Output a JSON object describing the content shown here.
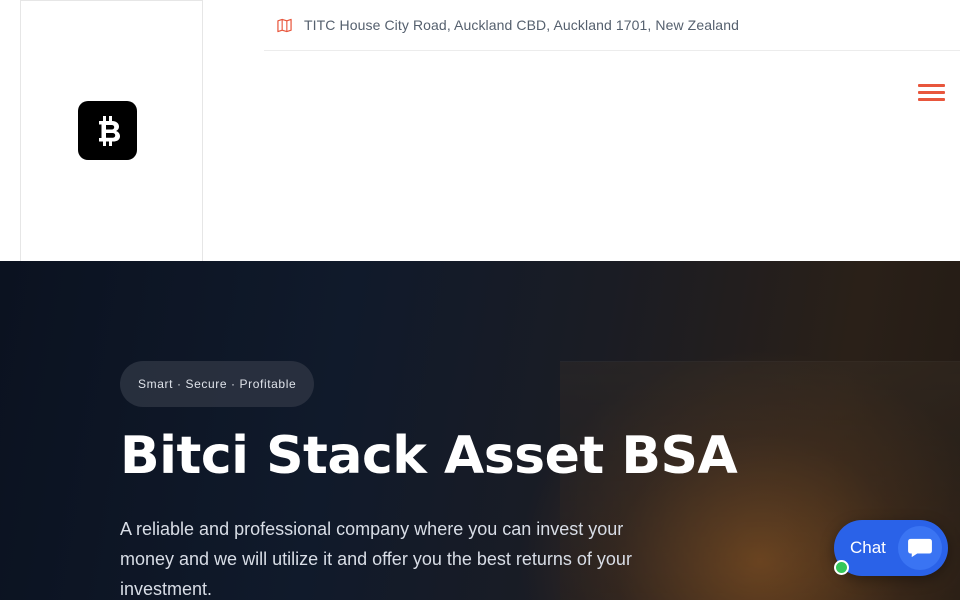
{
  "header": {
    "logo_name": "bitcoin-logo",
    "address": "TITC House City Road, Auckland CBD, Auckland 1701, New Zealand",
    "menu_icon": "hamburger-menu-icon",
    "accent_color": "#e8563c"
  },
  "hero": {
    "tagline": "Smart · Secure · Profitable",
    "title": "Bitci Stack Asset BSA",
    "description": "A reliable and professional company where you can invest your money and we will utilize it and offer you the best returns of your investment."
  },
  "chat": {
    "label": "Chat",
    "icon": "chat-bubble-icon",
    "status": "online",
    "color": "#2a62e8"
  }
}
